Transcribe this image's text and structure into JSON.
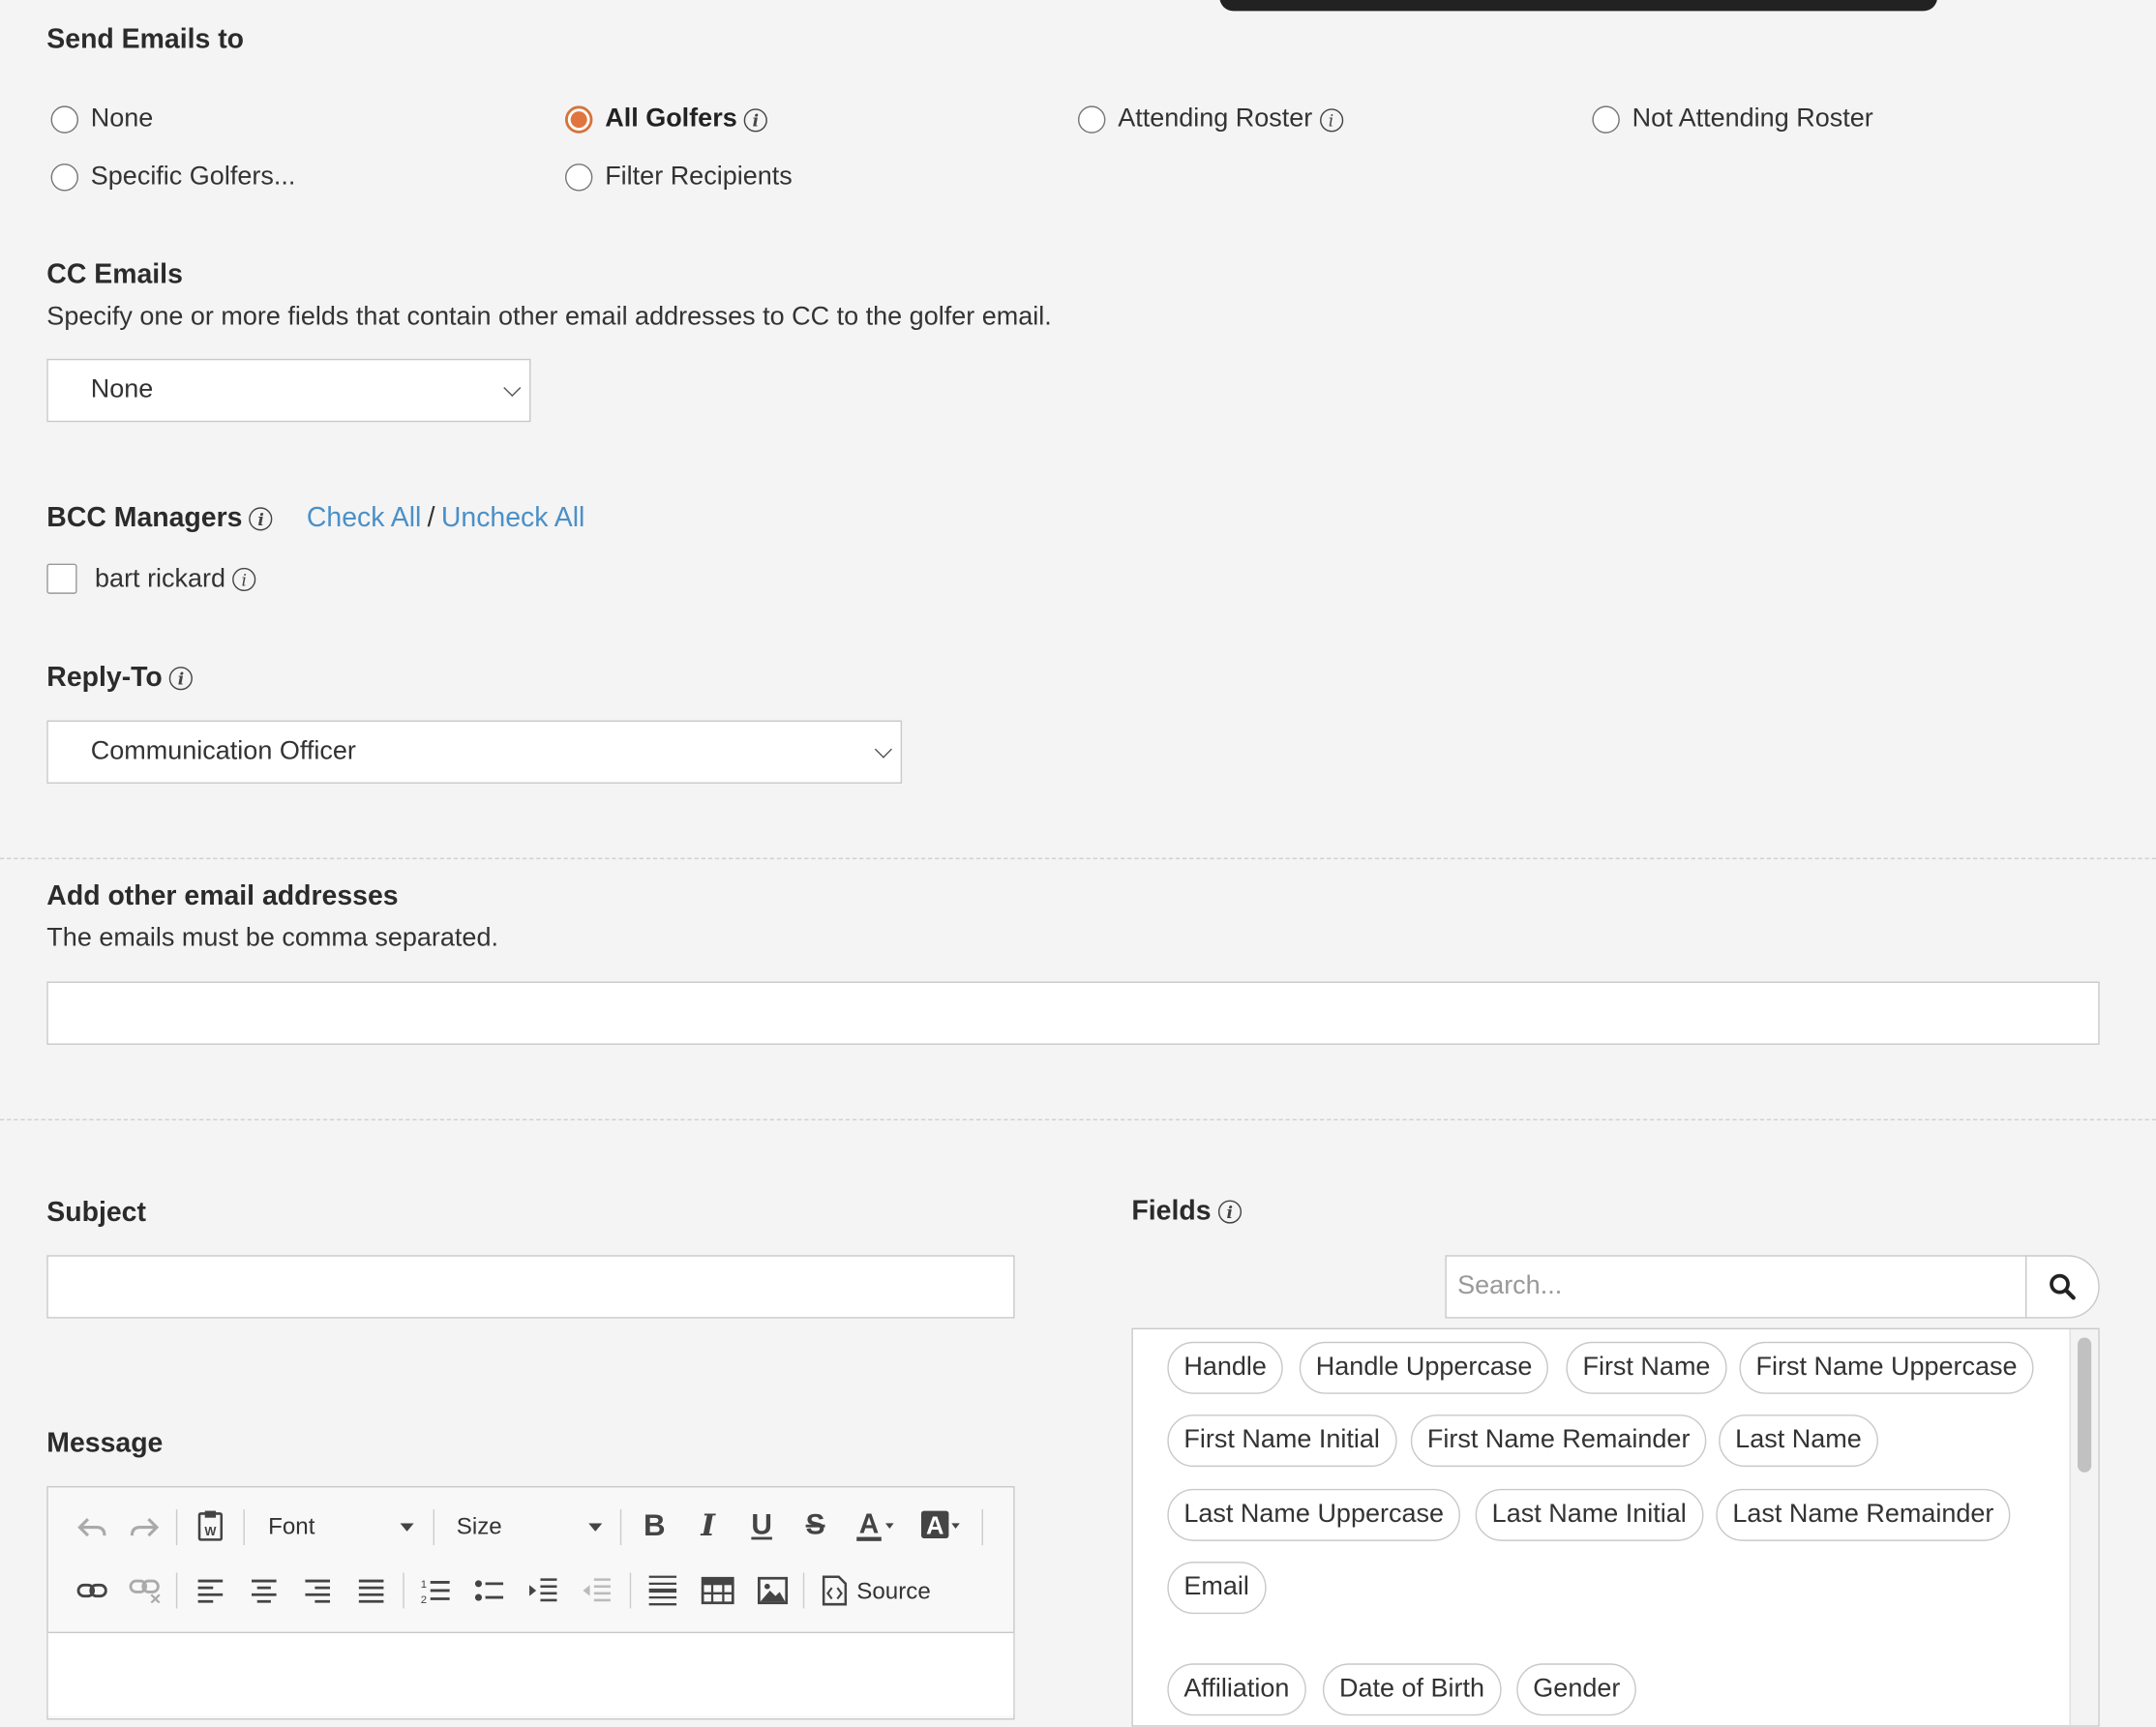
{
  "send_emails": {
    "title": "Send Emails to",
    "options": [
      {
        "label": "None",
        "selected": false
      },
      {
        "label": "All Golfers",
        "selected": true
      },
      {
        "label": "Attending Roster",
        "selected": false
      },
      {
        "label": "Not Attending Roster",
        "selected": false
      },
      {
        "label": "Specific Golfers...",
        "selected": false
      },
      {
        "label": "Filter Recipients",
        "selected": false
      }
    ]
  },
  "cc_emails": {
    "title": "CC Emails",
    "description": "Specify one or more fields that contain other email addresses to CC to the golfer email.",
    "selected": "None"
  },
  "bcc": {
    "title": "BCC Managers",
    "check_all": "Check All",
    "separator": "/",
    "uncheck_all": "Uncheck All",
    "managers": [
      {
        "name": "bart rickard",
        "checked": false
      }
    ]
  },
  "reply_to": {
    "title": "Reply-To",
    "selected": "Communication Officer"
  },
  "other_emails": {
    "title": "Add other email addresses",
    "description": "The emails must be comma separated.",
    "value": ""
  },
  "subject": {
    "title": "Subject",
    "value": ""
  },
  "message": {
    "title": "Message",
    "toolbar": {
      "font": "Font",
      "size": "Size",
      "source": "Source"
    }
  },
  "fields": {
    "title": "Fields",
    "search_placeholder": "Search...",
    "chips": [
      "Handle",
      "Handle Uppercase",
      "First Name",
      "First Name Uppercase",
      "First Name Initial",
      "First Name Remainder",
      "Last Name",
      "Last Name Uppercase",
      "Last Name Initial",
      "Last Name Remainder",
      "Email",
      "Affiliation",
      "Date of Birth",
      "Gender"
    ]
  },
  "colors": {
    "accent": "#e0763e",
    "link": "#4a90c8"
  }
}
